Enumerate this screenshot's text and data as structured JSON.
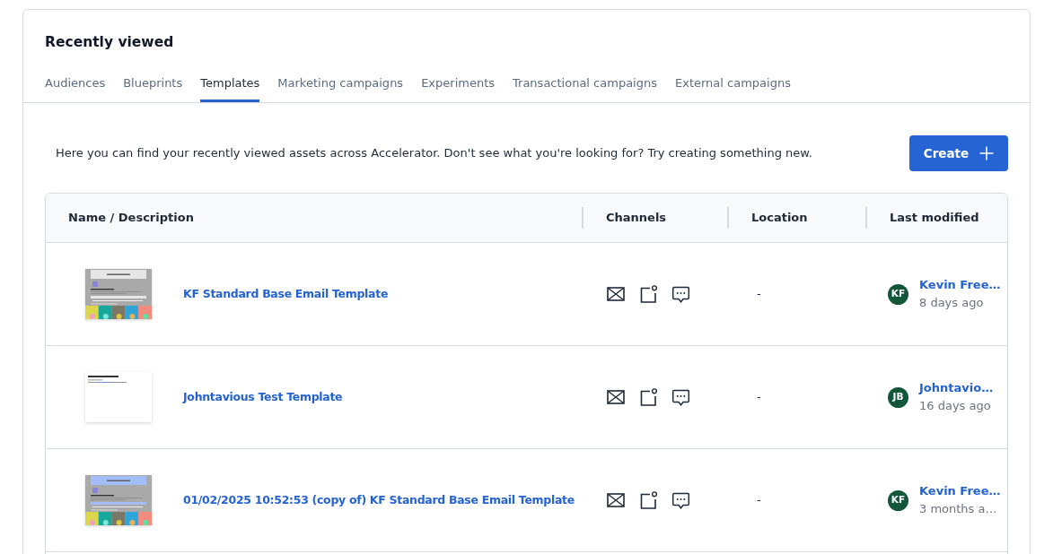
{
  "title": "Recently viewed",
  "tabs": [
    {
      "label": "Audiences",
      "selected": false
    },
    {
      "label": "Blueprints",
      "selected": false
    },
    {
      "label": "Templates",
      "selected": true
    },
    {
      "label": "Marketing campaigns",
      "selected": false
    },
    {
      "label": "Experiments",
      "selected": false
    },
    {
      "label": "Transactional campaigns",
      "selected": false
    },
    {
      "label": "External campaigns",
      "selected": false
    }
  ],
  "intro": "Here you can find your recently viewed assets across Accelerator. Don't see what you're looking for? Try creating something new.",
  "create_button": {
    "label": "Create"
  },
  "table": {
    "columns": [
      "Name / Description",
      "Channels",
      "Location",
      "Last modified"
    ],
    "rows": [
      {
        "preview": {
          "kind": "tiles",
          "color": "#e6e6e6"
        },
        "name": "KF Standard Base Email Template",
        "channels": [
          {
            "kind": "email"
          },
          {
            "kind": "in_app"
          },
          {
            "kind": "sms"
          }
        ],
        "location": "-",
        "modified_by": {
          "initials": "KF",
          "name": "Kevin Free…"
        },
        "modified": "8 days ago"
      },
      {
        "preview": {
          "kind": "text"
        },
        "name": "Johntavious Test Template",
        "channels": [
          {
            "kind": "email"
          },
          {
            "kind": "in_app"
          },
          {
            "kind": "sms"
          }
        ],
        "location": "-",
        "modified_by": {
          "initials": "JB",
          "name": "Johntavio…"
        },
        "modified": "16 days ago"
      },
      {
        "preview": {
          "kind": "tiles",
          "color": "#a3bdf8"
        },
        "name": "01/02/2025 10:52:53 (copy of) KF Standard Base Email Template",
        "channels": [
          {
            "kind": "email"
          },
          {
            "kind": "in_app"
          },
          {
            "kind": "sms"
          }
        ],
        "location": "-",
        "modified_by": {
          "initials": "KF",
          "name": "Kevin Free…"
        },
        "modified": "3 months a…"
      }
    ]
  }
}
